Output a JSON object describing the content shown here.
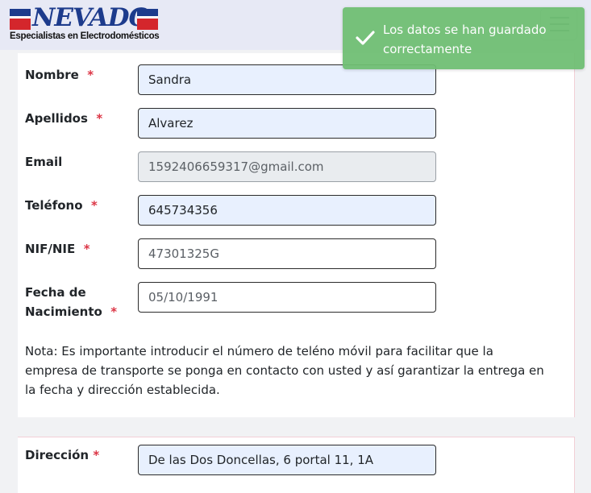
{
  "header": {
    "logo_word": "NEVADO",
    "logo_subtitle": "Especialistas en Electrodomésticos",
    "brand_colors": {
      "blue": "#1d3b8c",
      "red": "#d4262c"
    }
  },
  "toast": {
    "message": "Los datos se han guardado correctamente",
    "icon": "check-icon",
    "color": "#6fbf73"
  },
  "form": {
    "required_marker": "*",
    "nombre": {
      "label": "Nombre",
      "value": "Sandra"
    },
    "apellidos": {
      "label": "Apellidos",
      "value": "Alvarez"
    },
    "email": {
      "label": "Email",
      "value": "1592406659317@gmail.com"
    },
    "telefono": {
      "label": "Teléfono",
      "value": "645734356"
    },
    "nif": {
      "label": "NIF/NIE",
      "value": "47301325G"
    },
    "fecha": {
      "label_line1": "Fecha de",
      "label_line2": "Nacimiento",
      "value": "05/10/1991"
    },
    "note": "Nota: Es importante introducir el número de teléno móvil para facilitar que la empresa de transporte se ponga en contacto con usted y así garantizar la entrega en la fecha y dirección establecida.",
    "direccion": {
      "label": "Dirección",
      "value": "De las Dos Doncellas, 6 portal 11, 1A"
    }
  }
}
